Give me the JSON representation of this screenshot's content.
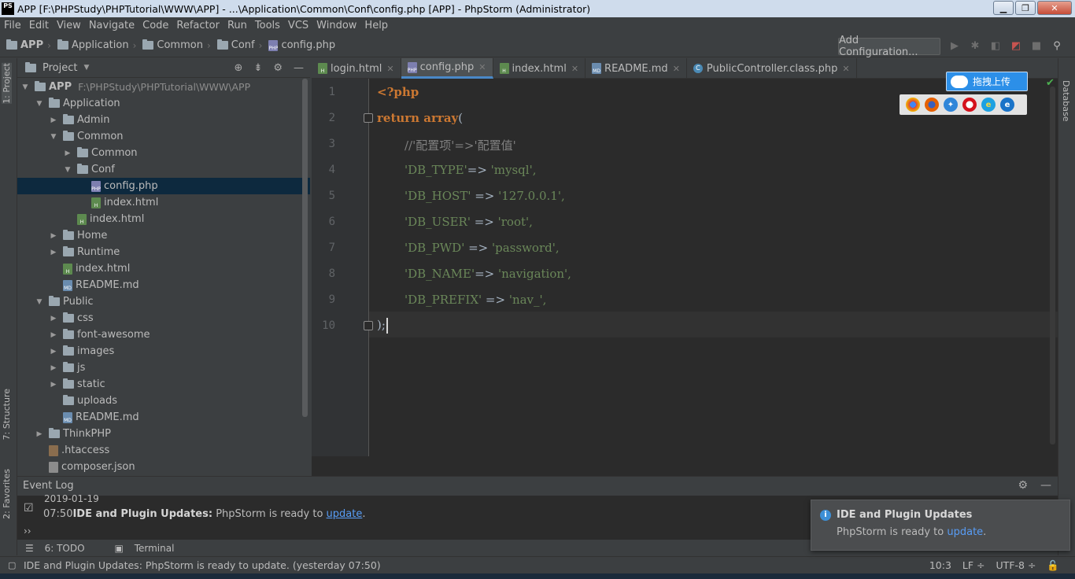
{
  "window": {
    "logo": "PS",
    "title": "APP [F:\\PHPStudy\\PHPTutorial\\WWW\\APP] - ...\\Application\\Common\\Conf\\config.php [APP] - PhpStorm (Administrator)"
  },
  "menu": [
    "File",
    "Edit",
    "View",
    "Navigate",
    "Code",
    "Refactor",
    "Run",
    "Tools",
    "VCS",
    "Window",
    "Help"
  ],
  "breadcrumb": [
    "APP",
    "Application",
    "Common",
    "Conf",
    "config.php"
  ],
  "toolbar": {
    "add_config": "Add Configuration..."
  },
  "left_strip": {
    "project": "1: Project",
    "structure": "7: Structure",
    "favorites": "2: Favorites"
  },
  "right_strip": {
    "database": "Database"
  },
  "project_panel": {
    "title": "Project",
    "tree": [
      {
        "label": "APP",
        "path": "F:\\PHPStudy\\PHPTutorial\\WWW\\APP"
      },
      {
        "label": "Application"
      },
      {
        "label": "Admin"
      },
      {
        "label": "Common"
      },
      {
        "label": "Common"
      },
      {
        "label": "Conf"
      },
      {
        "label": "config.php"
      },
      {
        "label": "index.html"
      },
      {
        "label": "index.html"
      },
      {
        "label": "Home"
      },
      {
        "label": "Runtime"
      },
      {
        "label": "index.html"
      },
      {
        "label": "README.md"
      },
      {
        "label": "Public"
      },
      {
        "label": "css"
      },
      {
        "label": "font-awesome"
      },
      {
        "label": "images"
      },
      {
        "label": "js"
      },
      {
        "label": "static"
      },
      {
        "label": "uploads"
      },
      {
        "label": "README.md"
      },
      {
        "label": "ThinkPHP"
      },
      {
        "label": ".htaccess"
      },
      {
        "label": "composer.json"
      }
    ]
  },
  "tabs": [
    {
      "label": "login.html"
    },
    {
      "label": "config.php"
    },
    {
      "label": "index.html"
    },
    {
      "label": "README.md"
    },
    {
      "label": "PublicController.class.php"
    }
  ],
  "editor": {
    "line_numbers": [
      "1",
      "2",
      "3",
      "4",
      "5",
      "6",
      "7",
      "8",
      "9",
      "10"
    ],
    "lines": {
      "l1": "<?php",
      "l2_kw": "return array",
      "l2_op": "(",
      "l3": "//'配置项'=>'配置值'",
      "l4_key": "'DB_TYPE'",
      "l4_op": "=> ",
      "l4_val": "'mysql',",
      "l5_key": "'DB_HOST' ",
      "l5_op": "=> ",
      "l5_val": "'127.0.0.1',",
      "l6_key": "'DB_USER' ",
      "l6_op": "=> ",
      "l6_val": "'root',",
      "l7_key": "'DB_PWD' ",
      "l7_op": "=> ",
      "l7_val": "'password',",
      "l8_key": "'DB_NAME'",
      "l8_op": "=> ",
      "l8_val": "'navigation',",
      "l9_key": "'DB_PREFIX' ",
      "l9_op": "=> ",
      "l9_val": "'nav_',",
      "l10": ");"
    }
  },
  "upload_widget": {
    "label": "拖拽上传"
  },
  "browsers": [
    "chrome-icon",
    "firefox-icon",
    "safari-icon",
    "opera-icon",
    "ie-icon",
    "edge-icon"
  ],
  "event_log": {
    "title": "Event Log",
    "date": "2019-01-19",
    "time": "07:50",
    "bold": "IDE and Plugin Updates:",
    "text": " PhpStorm is ready to ",
    "link": "update",
    "tail": "."
  },
  "bottom_tabs": {
    "todo": "6: TODO",
    "terminal": "Terminal"
  },
  "status": {
    "message": "IDE and Plugin Updates: PhpStorm is ready to update. (yesterday 07:50)",
    "position": "10:3",
    "line_sep": "LF ÷",
    "encoding": "UTF-8 ÷"
  },
  "balloon": {
    "title": "IDE and Plugin Updates",
    "text": "PhpStorm is ready to ",
    "link": "update",
    "tail": "."
  },
  "colors": {
    "background": "#2b2b2b",
    "keyword": "#cc7832",
    "string": "#6a8759",
    "comment": "#808080",
    "selection": "#0d293e",
    "link": "#589df6"
  }
}
